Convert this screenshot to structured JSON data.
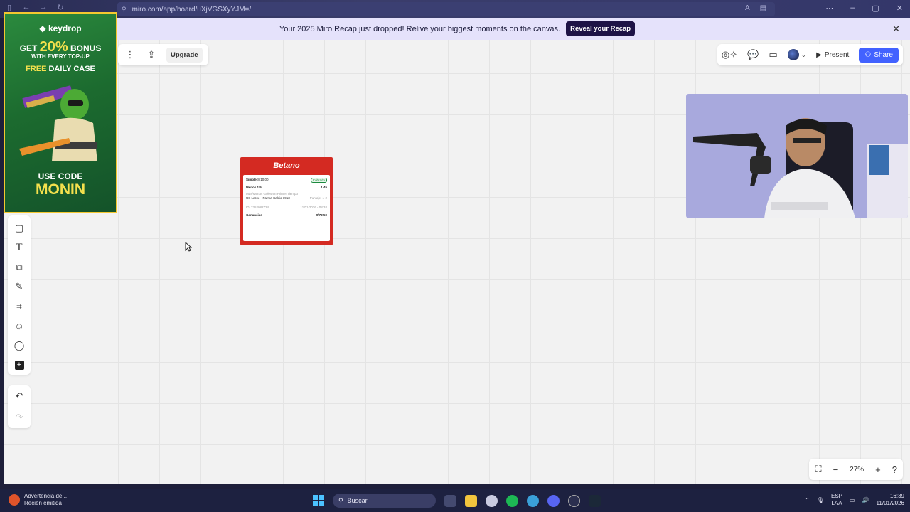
{
  "browser": {
    "url": "miro.com/app/board/uXjVGSXyYJM=/"
  },
  "banner": {
    "message": "Your 2025 Miro Recap just dropped! Relive your biggest moments on the canvas.",
    "button": "Reveal your Recap"
  },
  "toolbar_top_left": {
    "upgrade": "Upgrade"
  },
  "toolbar_top_right": {
    "present": "Present",
    "share": "Share"
  },
  "left_tools": [
    {
      "name": "sticky-note-icon",
      "glyph": "▢"
    },
    {
      "name": "text-icon",
      "glyph": "T"
    },
    {
      "name": "shapes-icon",
      "glyph": "⧉"
    },
    {
      "name": "pen-icon",
      "glyph": "✎"
    },
    {
      "name": "frame-icon",
      "glyph": "#"
    },
    {
      "name": "template-icon",
      "glyph": "☺"
    },
    {
      "name": "comment-icon",
      "glyph": "◯"
    },
    {
      "name": "add-icon",
      "glyph": "+"
    }
  ],
  "ad": {
    "brand": "keydrop",
    "get_prefix": "GET",
    "percent": "20%",
    "bonus": "BONUS",
    "every": "WITH EVERY TOP-UP",
    "free_prefix": "FREE",
    "free_rest": "DAILY CASE",
    "usecode": "USE CODE",
    "code": "MONIN"
  },
  "betano": {
    "logo": "Betano",
    "bet_type": "Simple",
    "stake": "S/10.00",
    "status": "Cobrado",
    "market": "Menos 1.5",
    "odds": "1.45",
    "market_desc": "Más/Menos Goles en Primer Tiempo",
    "match": "US Lecce - Parma Calcio 1913",
    "score": "Puntaje: 1-2",
    "bet_id": "ID: 2352082724",
    "datetime": "11/01/2026 - 08:34",
    "gains_label": "Ganancias",
    "gains_value": "S/72.50"
  },
  "zoom": {
    "percent": "27%"
  },
  "taskbar": {
    "notif_title": "Advertencia de...",
    "notif_sub": "Recién emitida",
    "search": "Buscar",
    "lang": "ESP",
    "lang_sub": "LAA",
    "time": "16:39",
    "date": "11/01/2026"
  }
}
